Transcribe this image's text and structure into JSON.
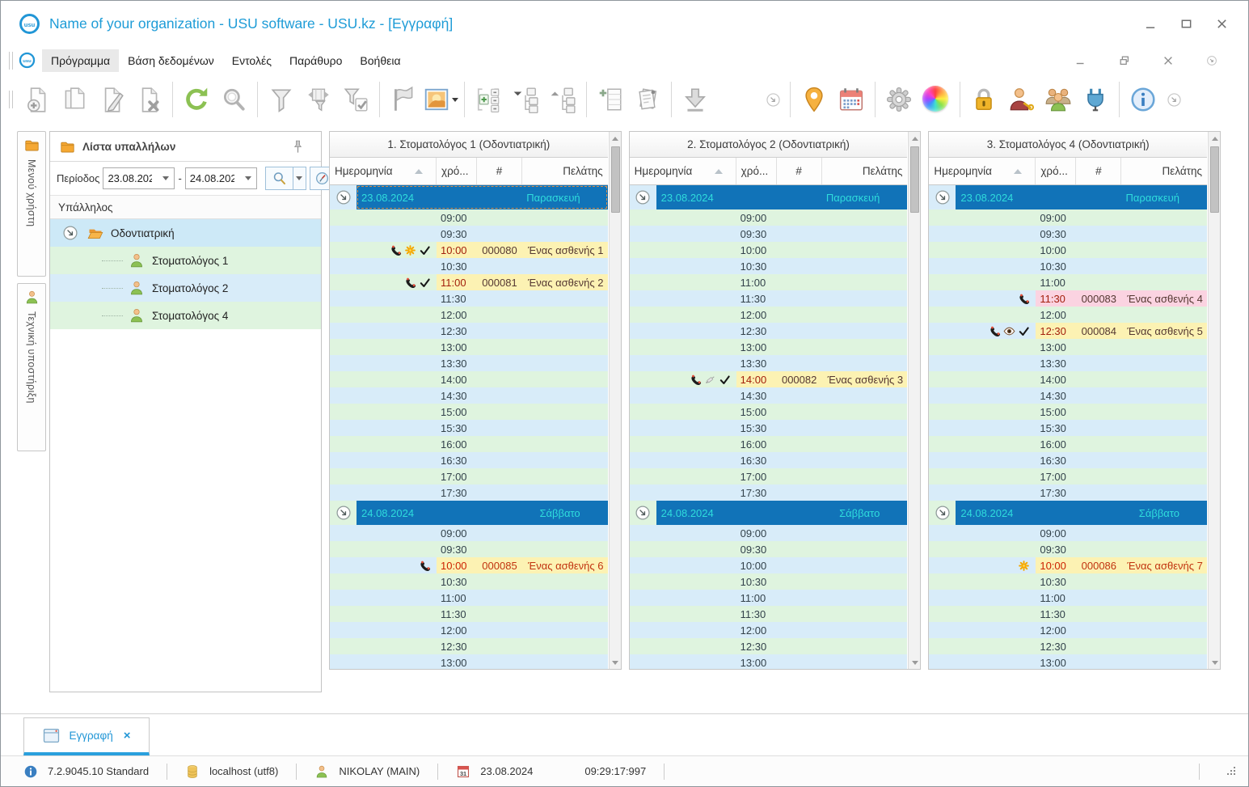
{
  "window": {
    "title": "Name of your organization - USU software - USU.kz - [Εγγραφή]"
  },
  "menu": {
    "items": [
      "Πρόγραμμα",
      "Βάση δεδομένων",
      "Εντολές",
      "Παράθυρο",
      "Βοήθεια"
    ],
    "active_item": "Πρόγραμμα"
  },
  "toolbar": {
    "groups": [
      [
        "new-record",
        "copy-record",
        "edit-record",
        "delete-record"
      ],
      [
        "refresh",
        "search"
      ],
      [
        "filter",
        "filter-columns",
        "filter-apply"
      ],
      [
        "flag",
        "image-select"
      ],
      [
        "row-expand",
        "tree-collapse",
        "tree-expand"
      ],
      [
        "add-row",
        "report"
      ],
      [
        "download"
      ],
      [
        "overflow-chevron"
      ],
      [
        "map-pin",
        "calendar"
      ],
      [
        "settings",
        "color-theme"
      ],
      [
        "lock",
        "user-permissions",
        "user-group",
        "plugin"
      ],
      [
        "info"
      ],
      [
        "overflow-chevron"
      ]
    ]
  },
  "sidebar": {
    "tabs": [
      {
        "label": "Μενού χρήστη",
        "icon": "folder"
      },
      {
        "label": "Τεχνική υποστήριξη",
        "icon": "person"
      }
    ],
    "panel": {
      "title": "Λίστα υπαλλήλων",
      "period_label": "Περίοδος",
      "date_from": "23.08.202",
      "date_to": "24.08.202",
      "list_header": "Υπάλληλος",
      "tree": {
        "root": "Οδοντιατρική",
        "children": [
          "Στοματολόγος 1",
          "Στοματολόγος 2",
          "Στοματολόγος 4"
        ]
      }
    }
  },
  "schedule": {
    "headers": {
      "date": "Ημερομηνία",
      "time": "χρό...",
      "number": "#",
      "client": "Πελάτης"
    },
    "days": [
      {
        "date": "23.08.2024",
        "weekday": "Παρασκευή",
        "times": [
          "09:00",
          "09:30",
          "10:00",
          "10:30",
          "11:00",
          "11:30",
          "12:00",
          "12:30",
          "13:00",
          "13:30",
          "14:00",
          "14:30",
          "15:00",
          "15:30",
          "16:00",
          "16:30",
          "17:00",
          "17:30"
        ]
      },
      {
        "date": "24.08.2024",
        "weekday": "Σάββατο",
        "times": [
          "09:00",
          "09:30",
          "10:00",
          "10:30",
          "11:00",
          "11:30",
          "12:00",
          "12:30",
          "13:00"
        ]
      }
    ],
    "selected_date": {
      "column": 0,
      "day": 0
    },
    "columns": [
      {
        "title": "1. Στοματολόγος 1 (Οδοντιατρική)",
        "appointments": [
          {
            "day": 0,
            "time": "10:00",
            "number": "000080",
            "client": "Ένας ασθενής 1",
            "icons": [
              "phone",
              "asterisk",
              "check"
            ],
            "highlight": "yellow",
            "style": "muted"
          },
          {
            "day": 0,
            "time": "11:00",
            "number": "000081",
            "client": "Ένας ασθενής 2",
            "icons": [
              "phone",
              "check"
            ],
            "highlight": "yellow",
            "style": "muted"
          },
          {
            "day": 1,
            "time": "10:00",
            "number": "000085",
            "client": "Ένας ασθενής 6",
            "icons": [
              "phone"
            ],
            "highlight": "yellow",
            "style": "bright"
          }
        ]
      },
      {
        "title": "2. Στοματολόγος 2 (Οδοντιατρική)",
        "appointments": [
          {
            "day": 0,
            "time": "14:00",
            "number": "000082",
            "client": "Ένας ασθενής 3",
            "icons": [
              "phone",
              "syringe",
              "check"
            ],
            "highlight": "yellow",
            "style": "muted"
          }
        ]
      },
      {
        "title": "3. Στοματολόγος 4 (Οδοντιατρική)",
        "appointments": [
          {
            "day": 0,
            "time": "11:30",
            "number": "000083",
            "client": "Ένας ασθενής 4",
            "icons": [
              "phone"
            ],
            "highlight": "pink",
            "style": "muted"
          },
          {
            "day": 0,
            "time": "12:30",
            "number": "000084",
            "client": "Ένας ασθενής 5",
            "icons": [
              "phone",
              "eye",
              "check"
            ],
            "highlight": "yellow",
            "style": "muted"
          },
          {
            "day": 1,
            "time": "10:00",
            "number": "000086",
            "client": "Ένας ασθενής 7",
            "icons": [
              "asterisk"
            ],
            "highlight": "yellow",
            "style": "bright"
          }
        ]
      }
    ]
  },
  "bottom_tabs": {
    "active": {
      "label": "Εγγραφή",
      "close": "×"
    }
  },
  "statusbar": {
    "version": "7.2.9045.10 Standard",
    "database": "localhost (utf8)",
    "user": "NIKOLAY (MAIN)",
    "date": "23.08.2024",
    "time": "09:29:17:997"
  },
  "colors": {
    "accent_blue": "#1e9cd7",
    "date_row_bg": "#1173b8",
    "date_row_text": "#2fdcdc",
    "row_green": "#dff4df",
    "row_blue": "#d8ecf9",
    "appointment_yellow": "#fcf2b3",
    "appointment_pink": "#fbd3e1",
    "appointment_text_red": "#cc2200"
  }
}
